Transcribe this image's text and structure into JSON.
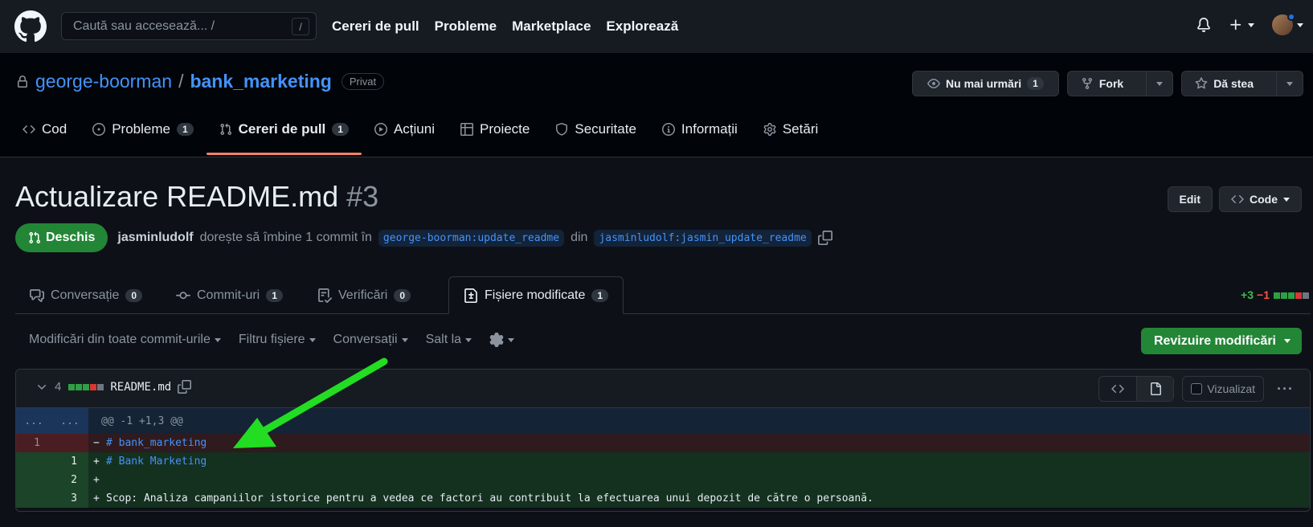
{
  "header": {
    "search_placeholder": "Caută sau accesează... /",
    "search_key": "/",
    "nav": [
      "Cereri de pull",
      "Probleme",
      "Marketplace",
      "Explorează"
    ]
  },
  "repo": {
    "owner": "george-boorman",
    "separator": "/",
    "name": "bank_marketing",
    "visibility": "Privat",
    "watch_label": "Nu mai urmări",
    "watch_count": "1",
    "fork_label": "Fork",
    "star_label": "Dă stea",
    "tabs": [
      {
        "label": "Cod",
        "count": ""
      },
      {
        "label": "Probleme",
        "count": "1"
      },
      {
        "label": "Cereri de pull",
        "count": "1"
      },
      {
        "label": "Acțiuni",
        "count": ""
      },
      {
        "label": "Proiecte",
        "count": ""
      },
      {
        "label": "Securitate",
        "count": ""
      },
      {
        "label": "Informații",
        "count": ""
      },
      {
        "label": "Setări",
        "count": ""
      }
    ]
  },
  "pr": {
    "title": "Actualizare README.md",
    "number": "#3",
    "edit_label": "Edit",
    "code_label": "Code",
    "state": "Deschis",
    "author": "jasminludolf",
    "summary": "dorește să îmbine 1 commit în",
    "base_branch": "george-boorman:update_readme",
    "from_word": "din",
    "head_branch": "jasminludolf:jasmin_update_readme",
    "tabs": [
      {
        "label": "Conversație",
        "count": "0"
      },
      {
        "label": "Commit-uri",
        "count": "1"
      },
      {
        "label": "Verificări",
        "count": "0"
      },
      {
        "label": "Fișiere modificate",
        "count": "1"
      }
    ],
    "additions": "+3",
    "deletions": "−1"
  },
  "toolbar": {
    "commits_filter": "Modificări din toate commit-urile",
    "file_filter": "Filtru fișiere",
    "conversations": "Conversații",
    "jump": "Salt la",
    "review_label": "Revizuire modificări"
  },
  "file": {
    "changes": "4",
    "name": "README.md",
    "viewed_label": "Vizualizat",
    "hunk_left": "...",
    "hunk_right": "...",
    "hunk_header": "@@ -1 +1,3 @@",
    "lines": [
      {
        "type": "del",
        "old": "1",
        "new": "",
        "marker": "−",
        "text": "# bank_marketing"
      },
      {
        "type": "add",
        "old": "",
        "new": "1",
        "marker": "+",
        "text": "# Bank Marketing"
      },
      {
        "type": "add",
        "old": "",
        "new": "2",
        "marker": "+",
        "text": ""
      },
      {
        "type": "add",
        "old": "",
        "new": "3",
        "marker": "+",
        "text": "Scop: Analiza campaniilor istorice pentru a vedea ce factori au contribuit la efectuarea unui depozit de către o persoană."
      }
    ]
  },
  "colors": {
    "accent": "#4493f8",
    "open_green": "#238636",
    "annotation_arrow": "#22dd22",
    "active_tab_underline": "#f78166"
  }
}
